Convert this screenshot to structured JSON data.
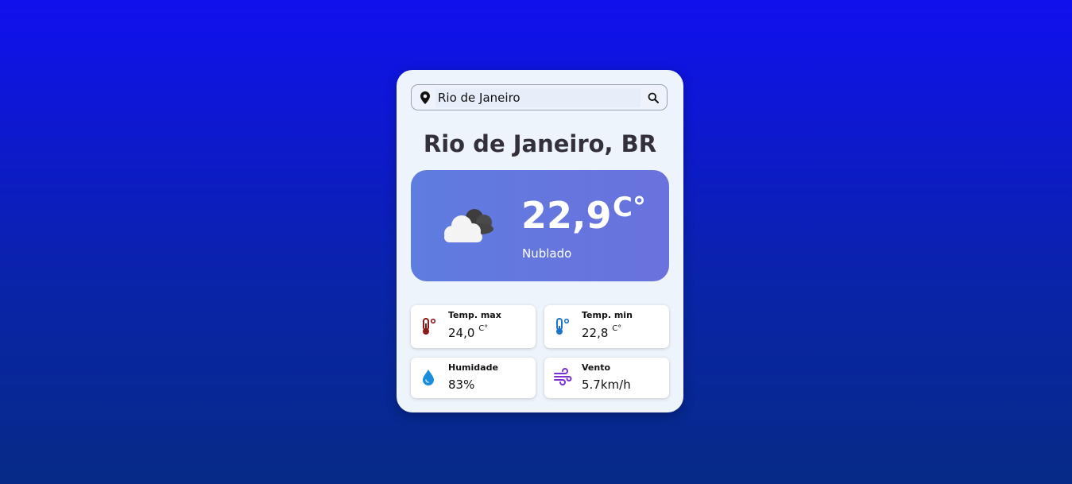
{
  "search": {
    "value": "Rio de Janeiro",
    "placeholder": ""
  },
  "location_title": "Rio de Janeiro, BR",
  "current": {
    "temperature": "22,9",
    "unit": "C°",
    "condition": "Nublado",
    "icon": "cloudy-icon"
  },
  "details": {
    "temp_max": {
      "label": "Temp. max",
      "value": "24,0",
      "unit": "C°",
      "icon": "thermometer-hot-icon",
      "color": "#8b1a1a"
    },
    "temp_min": {
      "label": "Temp. min",
      "value": "22,8",
      "unit": "C°",
      "icon": "thermometer-cold-icon",
      "color": "#1f74c9"
    },
    "humidity": {
      "label": "Humidade",
      "value": "83%",
      "icon": "water-drop-icon",
      "color": "#1a8ed8"
    },
    "wind": {
      "label": "Vento",
      "value": "5.7km/h",
      "icon": "wind-icon",
      "color": "#7a2fd6"
    }
  },
  "colors": {
    "background": "#1010ee",
    "card": "#eef4fb",
    "accent": "#6478e0"
  }
}
